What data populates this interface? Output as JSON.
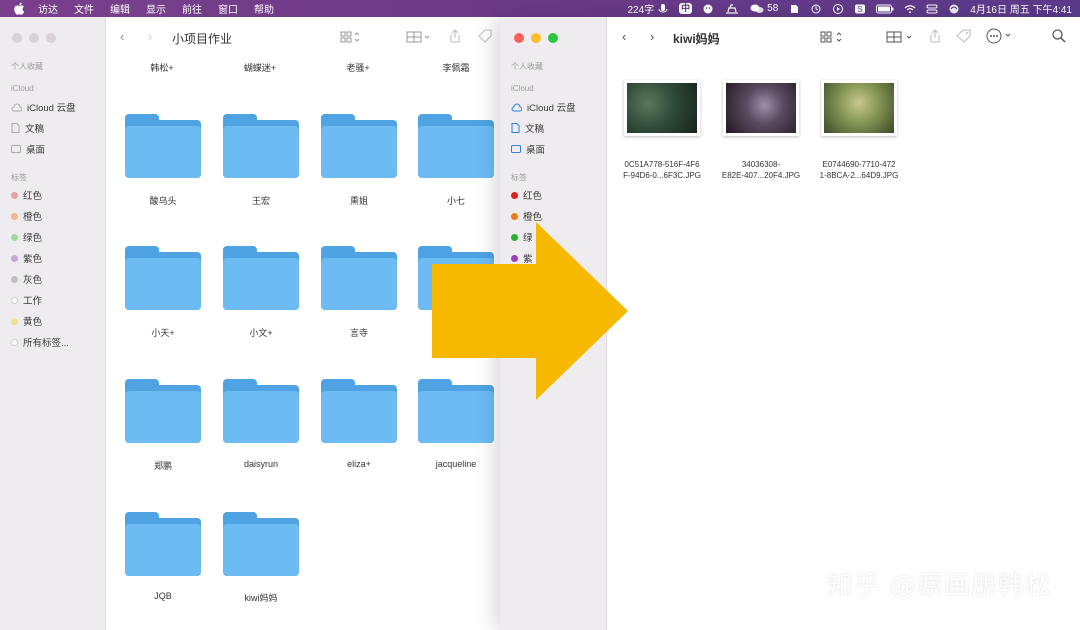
{
  "menubar": {
    "items": [
      "访达",
      "文件",
      "编辑",
      "显示",
      "前往",
      "窗口",
      "帮助"
    ],
    "word_count": "224字",
    "input_method": "中",
    "wechat_count": "58",
    "datetime": "4月16日 周五 下午4:41"
  },
  "left_window": {
    "title": "小项目作业",
    "sidebar": {
      "favorites_header": "个人收藏",
      "icloud_header": "iCloud",
      "icloud_drive": "iCloud 云盘",
      "documents": "文稿",
      "desktop": "桌面",
      "tags_header": "标签",
      "tags": [
        {
          "label": "红色",
          "color": "#e8a0a8"
        },
        {
          "label": "橙色",
          "color": "#f0b890"
        },
        {
          "label": "绿色",
          "color": "#a0d8a0"
        },
        {
          "label": "紫色",
          "color": "#c8a8d8"
        },
        {
          "label": "灰色",
          "color": "#c0c0c0"
        },
        {
          "label": "工作",
          "color": "#e8e8e8"
        },
        {
          "label": "黄色",
          "color": "#f0e090"
        },
        {
          "label": "所有标签...",
          "color": "#e8e8e8"
        }
      ]
    },
    "top_names": [
      "韩松+",
      "蝴蝶迷+",
      "老骚+",
      "李佩霜"
    ],
    "folders": [
      "酸乌头",
      "王宏",
      "熏姐",
      "小七",
      "小天+",
      "小文+",
      "言寺",
      "",
      "郑鹏",
      "daisyrun",
      "eliza+",
      "jacqueline",
      "JQB",
      "kiwi妈妈"
    ]
  },
  "right_window": {
    "title": "kiwi妈妈",
    "sidebar": {
      "favorites_header": "个人收藏",
      "icloud_header": "iCloud",
      "icloud_drive": "iCloud 云盘",
      "documents": "文稿",
      "desktop": "桌面",
      "tags_header": "标签",
      "tags": [
        {
          "label": "红色",
          "color": "#e02020"
        },
        {
          "label": "橙色",
          "color": "#f07a10"
        },
        {
          "label": "绿",
          "color": "#28b030"
        },
        {
          "label": "紫",
          "color": "#a040c0"
        }
      ]
    },
    "files": [
      {
        "line1": "0C51A778-516F-4F6",
        "line2": "F-94D6-0...6F3C.JPG"
      },
      {
        "line1": "34036308-",
        "line2": "E82E-407...20F4.JPG"
      },
      {
        "line1": "E0744690-7710-472",
        "line2": "1-8BCA-2...64D9.JPG"
      }
    ]
  },
  "watermark": "知乎 @原画册韩松",
  "colors": {
    "arrow": "#f7b800",
    "folder_front": "#6cbcf3",
    "folder_back": "#4fa3e3"
  }
}
